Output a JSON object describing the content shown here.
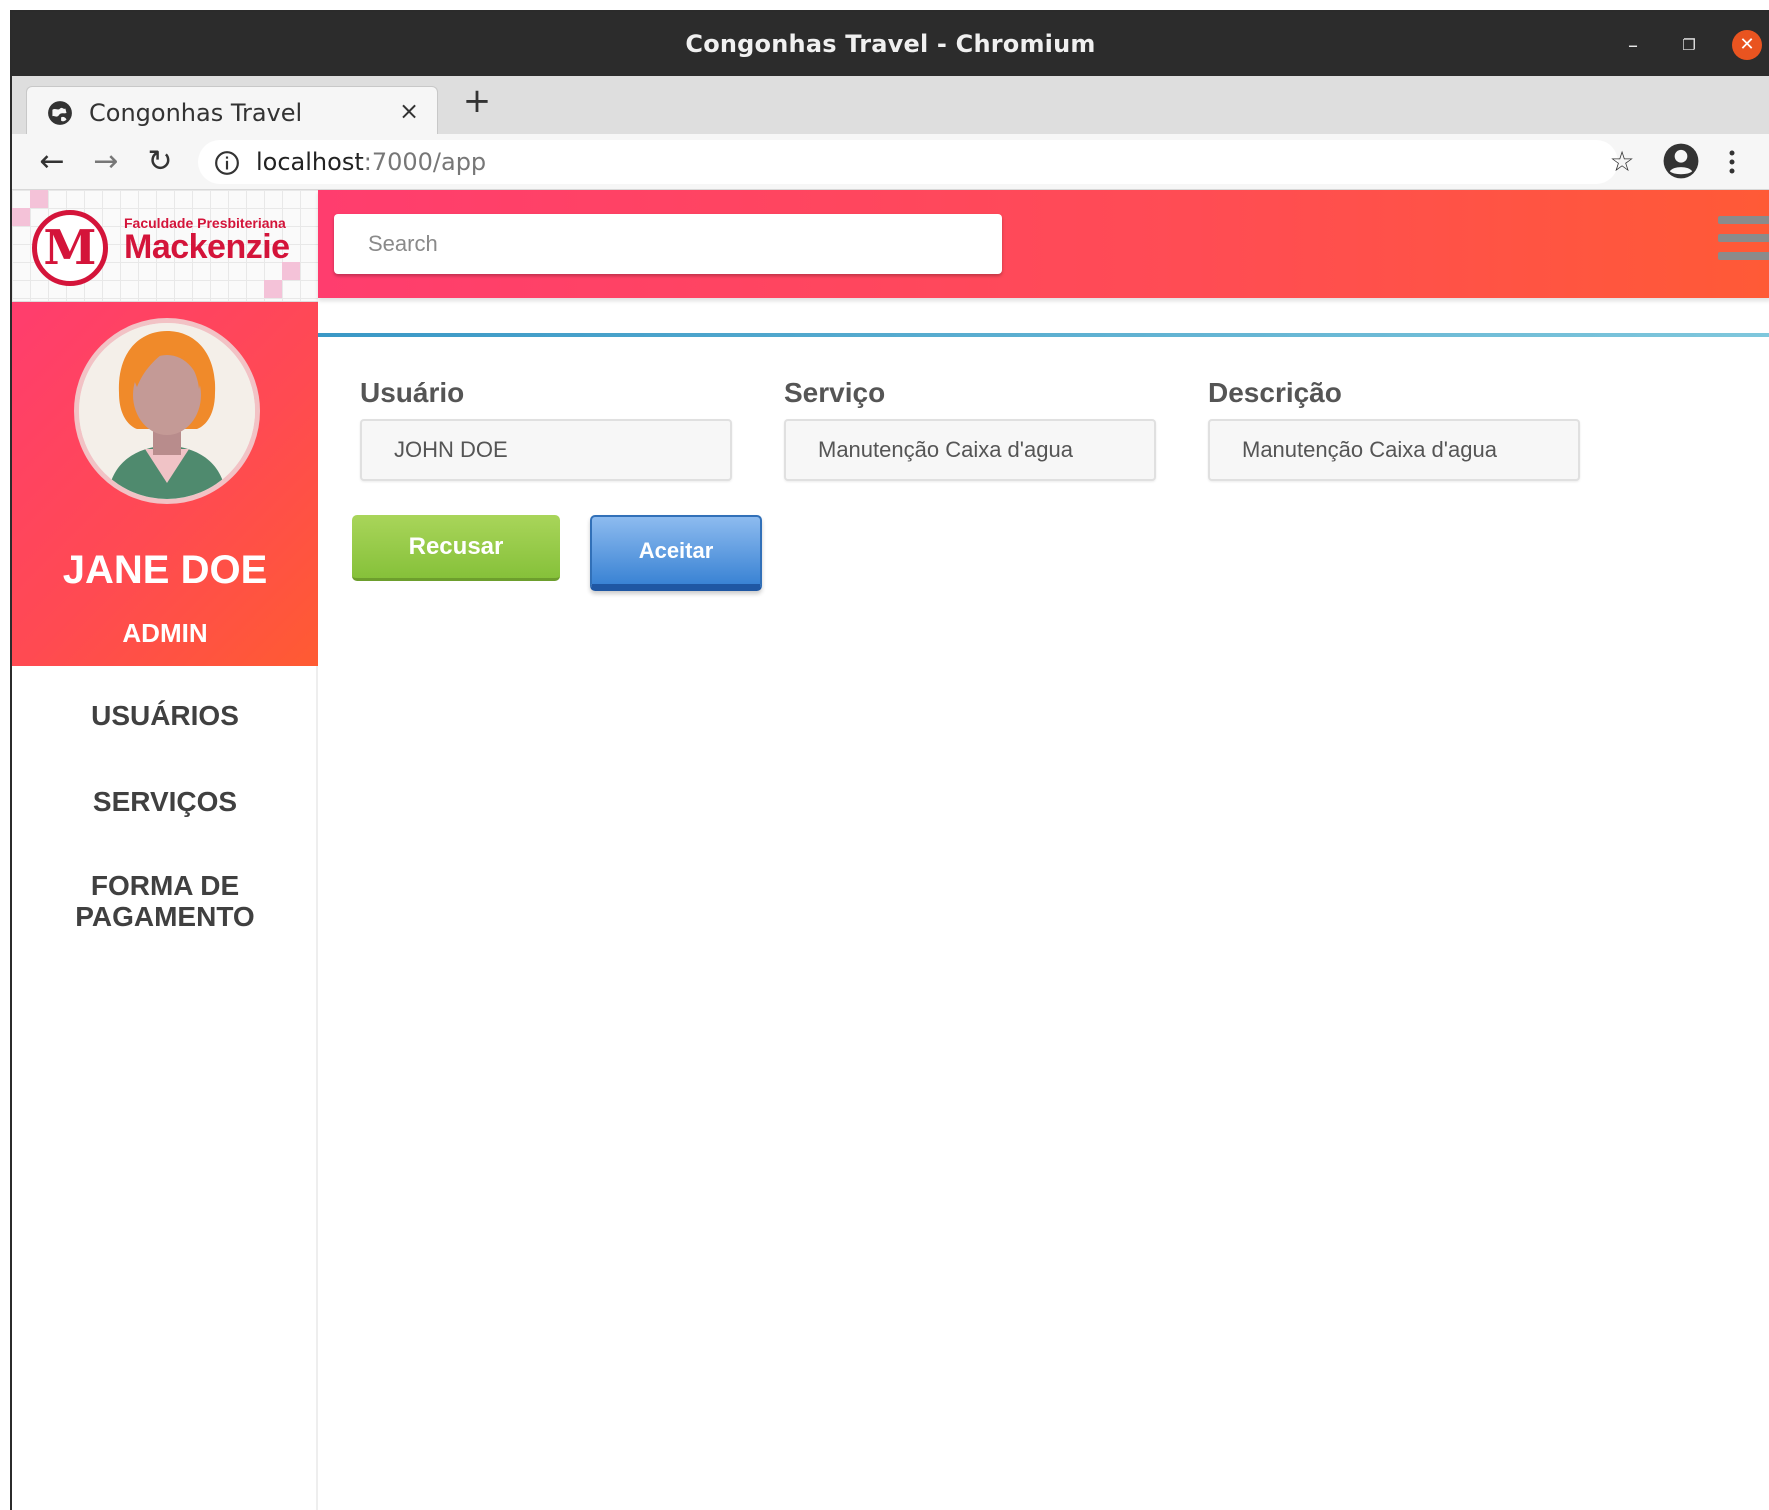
{
  "window": {
    "title": "Congonhas Travel - Chromium"
  },
  "browser": {
    "tab_title": "Congonhas Travel",
    "tab_close": "×",
    "new_tab": "+",
    "url_host": "localhost",
    "url_rest": ":7000/app"
  },
  "logo": {
    "letter": "M",
    "small_text": "Faculdade Presbiteriana",
    "big_text": "Mackenzie",
    "brand_color": "#d4143a"
  },
  "profile": {
    "name": "JANE DOE",
    "role": "ADMIN"
  },
  "nav": {
    "items": [
      {
        "label": "USUÁRIOS"
      },
      {
        "label": "SERVIÇOS"
      },
      {
        "label": "FORMA DE PAGAMENTO"
      }
    ]
  },
  "topbar": {
    "search_placeholder": "Search",
    "gradient_colors": [
      "#ff3d6e",
      "#ff5a36"
    ]
  },
  "form": {
    "fields": [
      {
        "label": "Usuário",
        "value": "JOHN DOE"
      },
      {
        "label": "Serviço",
        "value": "Manutenção Caixa d'agua"
      },
      {
        "label": "Descrição",
        "value": "Manutenção Caixa d'agua"
      }
    ],
    "reject_label": "Recusar",
    "accept_label": "Aceitar",
    "reject_color": "#8cc63f",
    "accept_color": "#3a83d4"
  },
  "icons": {
    "minimize": "minimize-icon",
    "maximize": "maximize-icon",
    "close": "close-icon",
    "back": "arrow-left-icon",
    "forward": "arrow-right-icon",
    "reload": "reload-icon",
    "info": "info-icon",
    "star": "star-icon",
    "profile": "account-circle-icon",
    "menu": "more-vert-icon",
    "hamburger": "hamburger-icon"
  }
}
